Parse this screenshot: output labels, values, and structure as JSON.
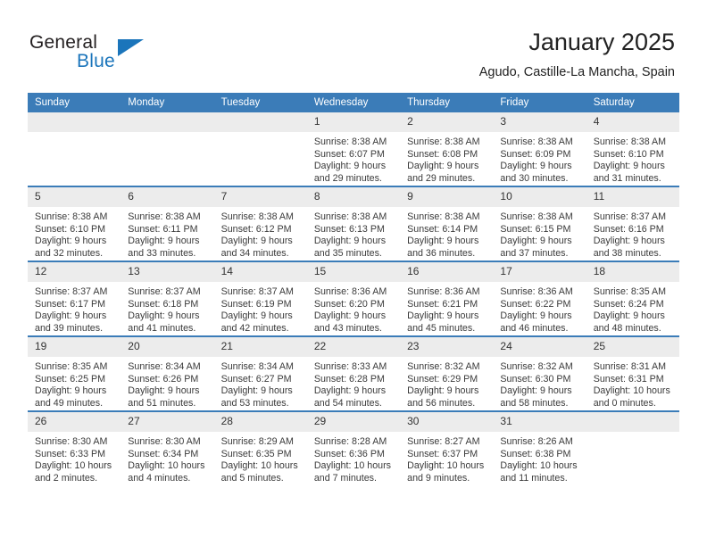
{
  "brand": {
    "name_part1": "General",
    "name_part2": "Blue",
    "accent_color": "#1b75bb",
    "triangle_icon": "triangle-icon"
  },
  "header": {
    "title": "January 2025",
    "subtitle": "Agudo, Castille-La Mancha, Spain"
  },
  "theme": {
    "header_row_color": "#3b7cb8",
    "daynum_background": "#ececec"
  },
  "calendar": {
    "weekday_headers": [
      "Sunday",
      "Monday",
      "Tuesday",
      "Wednesday",
      "Thursday",
      "Friday",
      "Saturday"
    ],
    "weeks": [
      [
        {
          "day": "",
          "lines": []
        },
        {
          "day": "",
          "lines": []
        },
        {
          "day": "",
          "lines": []
        },
        {
          "day": "1",
          "lines": [
            "Sunrise: 8:38 AM",
            "Sunset: 6:07 PM",
            "Daylight: 9 hours",
            "and 29 minutes."
          ]
        },
        {
          "day": "2",
          "lines": [
            "Sunrise: 8:38 AM",
            "Sunset: 6:08 PM",
            "Daylight: 9 hours",
            "and 29 minutes."
          ]
        },
        {
          "day": "3",
          "lines": [
            "Sunrise: 8:38 AM",
            "Sunset: 6:09 PM",
            "Daylight: 9 hours",
            "and 30 minutes."
          ]
        },
        {
          "day": "4",
          "lines": [
            "Sunrise: 8:38 AM",
            "Sunset: 6:10 PM",
            "Daylight: 9 hours",
            "and 31 minutes."
          ]
        }
      ],
      [
        {
          "day": "5",
          "lines": [
            "Sunrise: 8:38 AM",
            "Sunset: 6:10 PM",
            "Daylight: 9 hours",
            "and 32 minutes."
          ]
        },
        {
          "day": "6",
          "lines": [
            "Sunrise: 8:38 AM",
            "Sunset: 6:11 PM",
            "Daylight: 9 hours",
            "and 33 minutes."
          ]
        },
        {
          "day": "7",
          "lines": [
            "Sunrise: 8:38 AM",
            "Sunset: 6:12 PM",
            "Daylight: 9 hours",
            "and 34 minutes."
          ]
        },
        {
          "day": "8",
          "lines": [
            "Sunrise: 8:38 AM",
            "Sunset: 6:13 PM",
            "Daylight: 9 hours",
            "and 35 minutes."
          ]
        },
        {
          "day": "9",
          "lines": [
            "Sunrise: 8:38 AM",
            "Sunset: 6:14 PM",
            "Daylight: 9 hours",
            "and 36 minutes."
          ]
        },
        {
          "day": "10",
          "lines": [
            "Sunrise: 8:38 AM",
            "Sunset: 6:15 PM",
            "Daylight: 9 hours",
            "and 37 minutes."
          ]
        },
        {
          "day": "11",
          "lines": [
            "Sunrise: 8:37 AM",
            "Sunset: 6:16 PM",
            "Daylight: 9 hours",
            "and 38 minutes."
          ]
        }
      ],
      [
        {
          "day": "12",
          "lines": [
            "Sunrise: 8:37 AM",
            "Sunset: 6:17 PM",
            "Daylight: 9 hours",
            "and 39 minutes."
          ]
        },
        {
          "day": "13",
          "lines": [
            "Sunrise: 8:37 AM",
            "Sunset: 6:18 PM",
            "Daylight: 9 hours",
            "and 41 minutes."
          ]
        },
        {
          "day": "14",
          "lines": [
            "Sunrise: 8:37 AM",
            "Sunset: 6:19 PM",
            "Daylight: 9 hours",
            "and 42 minutes."
          ]
        },
        {
          "day": "15",
          "lines": [
            "Sunrise: 8:36 AM",
            "Sunset: 6:20 PM",
            "Daylight: 9 hours",
            "and 43 minutes."
          ]
        },
        {
          "day": "16",
          "lines": [
            "Sunrise: 8:36 AM",
            "Sunset: 6:21 PM",
            "Daylight: 9 hours",
            "and 45 minutes."
          ]
        },
        {
          "day": "17",
          "lines": [
            "Sunrise: 8:36 AM",
            "Sunset: 6:22 PM",
            "Daylight: 9 hours",
            "and 46 minutes."
          ]
        },
        {
          "day": "18",
          "lines": [
            "Sunrise: 8:35 AM",
            "Sunset: 6:24 PM",
            "Daylight: 9 hours",
            "and 48 minutes."
          ]
        }
      ],
      [
        {
          "day": "19",
          "lines": [
            "Sunrise: 8:35 AM",
            "Sunset: 6:25 PM",
            "Daylight: 9 hours",
            "and 49 minutes."
          ]
        },
        {
          "day": "20",
          "lines": [
            "Sunrise: 8:34 AM",
            "Sunset: 6:26 PM",
            "Daylight: 9 hours",
            "and 51 minutes."
          ]
        },
        {
          "day": "21",
          "lines": [
            "Sunrise: 8:34 AM",
            "Sunset: 6:27 PM",
            "Daylight: 9 hours",
            "and 53 minutes."
          ]
        },
        {
          "day": "22",
          "lines": [
            "Sunrise: 8:33 AM",
            "Sunset: 6:28 PM",
            "Daylight: 9 hours",
            "and 54 minutes."
          ]
        },
        {
          "day": "23",
          "lines": [
            "Sunrise: 8:32 AM",
            "Sunset: 6:29 PM",
            "Daylight: 9 hours",
            "and 56 minutes."
          ]
        },
        {
          "day": "24",
          "lines": [
            "Sunrise: 8:32 AM",
            "Sunset: 6:30 PM",
            "Daylight: 9 hours",
            "and 58 minutes."
          ]
        },
        {
          "day": "25",
          "lines": [
            "Sunrise: 8:31 AM",
            "Sunset: 6:31 PM",
            "Daylight: 10 hours",
            "and 0 minutes."
          ]
        }
      ],
      [
        {
          "day": "26",
          "lines": [
            "Sunrise: 8:30 AM",
            "Sunset: 6:33 PM",
            "Daylight: 10 hours",
            "and 2 minutes."
          ]
        },
        {
          "day": "27",
          "lines": [
            "Sunrise: 8:30 AM",
            "Sunset: 6:34 PM",
            "Daylight: 10 hours",
            "and 4 minutes."
          ]
        },
        {
          "day": "28",
          "lines": [
            "Sunrise: 8:29 AM",
            "Sunset: 6:35 PM",
            "Daylight: 10 hours",
            "and 5 minutes."
          ]
        },
        {
          "day": "29",
          "lines": [
            "Sunrise: 8:28 AM",
            "Sunset: 6:36 PM",
            "Daylight: 10 hours",
            "and 7 minutes."
          ]
        },
        {
          "day": "30",
          "lines": [
            "Sunrise: 8:27 AM",
            "Sunset: 6:37 PM",
            "Daylight: 10 hours",
            "and 9 minutes."
          ]
        },
        {
          "day": "31",
          "lines": [
            "Sunrise: 8:26 AM",
            "Sunset: 6:38 PM",
            "Daylight: 10 hours",
            "and 11 minutes."
          ]
        },
        {
          "day": "",
          "lines": []
        }
      ]
    ]
  }
}
